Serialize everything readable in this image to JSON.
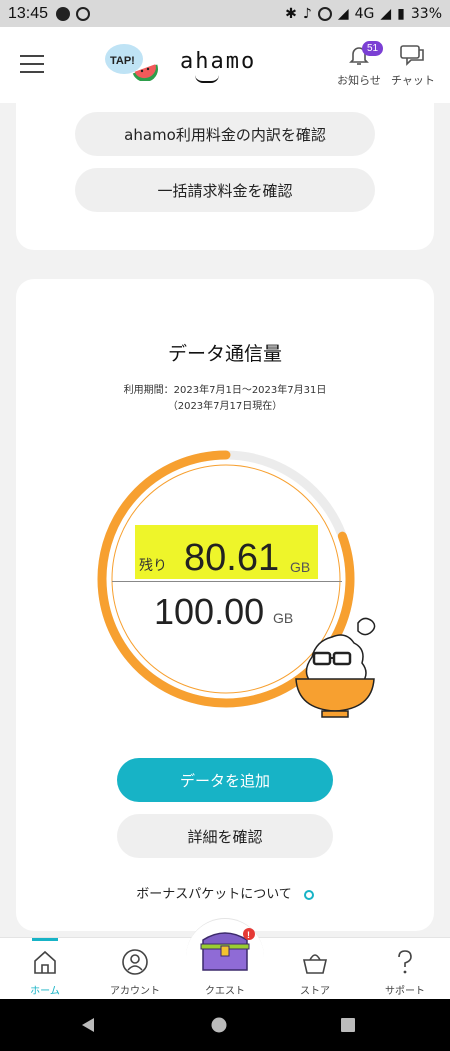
{
  "status_bar": {
    "time": "13:45",
    "network": "4G",
    "battery": "33%"
  },
  "header": {
    "logo_badge": "TAP!",
    "brand": "ahamo",
    "notifications": {
      "label": "お知らせ",
      "count": "51"
    },
    "chat": {
      "label": "チャット"
    }
  },
  "billing_card": {
    "breakdown_button": "ahamo利用料金の内訳を確認",
    "bulk_button": "一括請求料金を確認"
  },
  "data_card": {
    "title": "データ通信量",
    "period": "利用期間：2023年7月1日〜2023年7月31日",
    "as_of": "（2023年7月17日現在）",
    "remaining_label": "残り",
    "remaining_value": "80.61",
    "remaining_unit": "GB",
    "total_value": "100.00",
    "total_unit": "GB",
    "remaining_fraction": 0.8061,
    "add_data_button": "データを追加",
    "details_button": "詳細を確認",
    "bonus_link": "ボーナスパケットについて"
  },
  "colors": {
    "accent": "#17b3c6",
    "gauge": "#f7a030",
    "highlight": "#eef52a",
    "badge": "#7b3fd4"
  },
  "bottom_nav": [
    {
      "label": "ホーム",
      "icon": "home-icon",
      "active": true
    },
    {
      "label": "アカウント",
      "icon": "account-icon",
      "active": false
    },
    {
      "label": "クエスト",
      "icon": "treasure-chest-icon",
      "active": false
    },
    {
      "label": "ストア",
      "icon": "basket-icon",
      "active": false
    },
    {
      "label": "サポート",
      "icon": "question-icon",
      "active": false
    }
  ]
}
